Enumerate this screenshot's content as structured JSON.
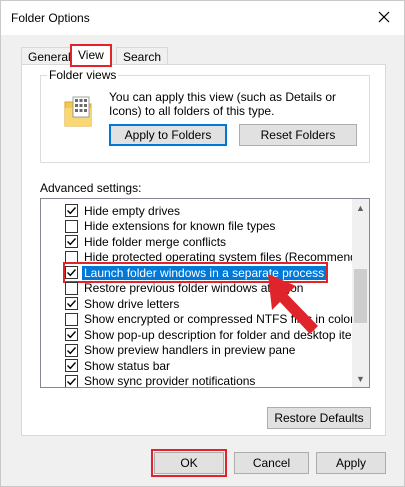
{
  "window": {
    "title": "Folder Options",
    "close_icon": "close-icon"
  },
  "tabs": [
    {
      "label": "General",
      "active": false
    },
    {
      "label": "View",
      "active": true
    },
    {
      "label": "Search",
      "active": false
    }
  ],
  "folder_views": {
    "legend": "Folder views",
    "description": "You can apply this view (such as Details or Icons) to all folders of this type.",
    "icon": "folder-icon",
    "apply_button": "Apply to Folders",
    "reset_button": "Reset Folders"
  },
  "advanced": {
    "label": "Advanced settings:",
    "items": [
      {
        "label": "Hide empty drives",
        "checked": true
      },
      {
        "label": "Hide extensions for known file types",
        "checked": false
      },
      {
        "label": "Hide folder merge conflicts",
        "checked": true
      },
      {
        "label": "Hide protected operating system files (Recommended)",
        "checked": false
      },
      {
        "label": "Launch folder windows in a separate process",
        "checked": true,
        "selected": true
      },
      {
        "label": "Restore previous folder windows at logon",
        "checked": false
      },
      {
        "label": "Show drive letters",
        "checked": true
      },
      {
        "label": "Show encrypted or compressed NTFS files in color",
        "checked": false
      },
      {
        "label": "Show pop-up description for folder and desktop items",
        "checked": true
      },
      {
        "label": "Show preview handlers in preview pane",
        "checked": true
      },
      {
        "label": "Show status bar",
        "checked": true
      },
      {
        "label": "Show sync provider notifications",
        "checked": true
      }
    ],
    "restore_defaults": "Restore Defaults"
  },
  "footer": {
    "ok": "OK",
    "cancel": "Cancel",
    "apply": "Apply"
  },
  "colors": {
    "highlight_red": "#e0242b",
    "selection_blue": "#0078d7"
  }
}
